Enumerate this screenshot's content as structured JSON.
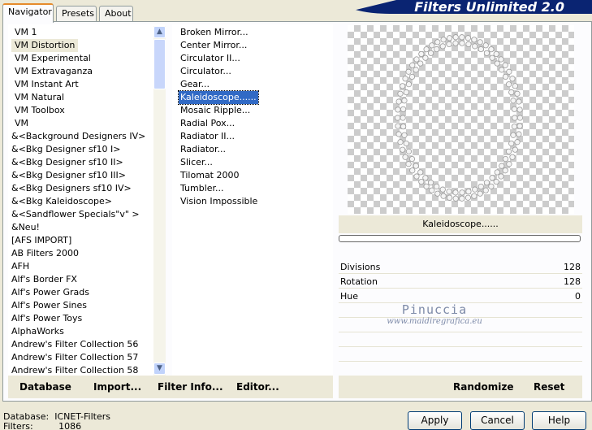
{
  "banner": {
    "title": "Filters Unlimited 2.0"
  },
  "tabs": [
    {
      "label": "Navigator"
    },
    {
      "label": "Presets"
    },
    {
      "label": "About"
    }
  ],
  "categories": [
    "VM 1",
    "VM Distortion",
    "VM Experimental",
    "VM Extravaganza",
    "VM Instant Art",
    "VM Natural",
    "VM Toolbox",
    "VM",
    "&<Background Designers IV>",
    "&<Bkg Designer sf10 I>",
    "&<Bkg Designer sf10 II>",
    "&<Bkg Designer sf10 III>",
    "&<Bkg Designers sf10 IV>",
    "&<Bkg Kaleidoscope>",
    "&<Sandflower Specials\"v\" >",
    "&Neu!",
    "[AFS IMPORT]",
    "AB Filters 2000",
    "AFH",
    "Alf's Border FX",
    "Alf's Power Grads",
    "Alf's Power Sines",
    "Alf's Power Toys",
    "AlphaWorks",
    "Andrew's Filter Collection 56",
    "Andrew's Filter Collection 57",
    "Andrew's Filter Collection 58"
  ],
  "selected_category": "VM Distortion",
  "filters": [
    "Broken Mirror...",
    "Center Mirror...",
    "Circulator II...",
    "Circulator...",
    "Gear...",
    "Kaleidoscope......",
    "Mosaic Ripple...",
    "Radial Pox...",
    "Radiator II...",
    "Radiator...",
    "Slicer...",
    "Tilomat 2000",
    "Tumbler...",
    "Vision Impossible"
  ],
  "selected_filter": "Kaleidoscope......",
  "filter_name": "Kaleidoscope......",
  "params": [
    {
      "label": "Divisions",
      "value": "128"
    },
    {
      "label": "Rotation",
      "value": "128"
    },
    {
      "label": "Hue",
      "value": "0"
    }
  ],
  "watermark": {
    "line1": "Pinuccia",
    "line2": "www.maidiregrafica.eu"
  },
  "left_buttons": {
    "database": "Database",
    "import": "Import...",
    "filter_info": "Filter Info...",
    "editor": "Editor..."
  },
  "right_buttons": {
    "randomize": "Randomize",
    "reset": "Reset"
  },
  "status": {
    "database_label": "Database:",
    "database_value": "ICNET-Filters",
    "filters_label": "Filters:",
    "filters_value": "1086"
  },
  "dialog_buttons": {
    "apply": "Apply",
    "cancel": "Cancel",
    "help": "Help"
  }
}
